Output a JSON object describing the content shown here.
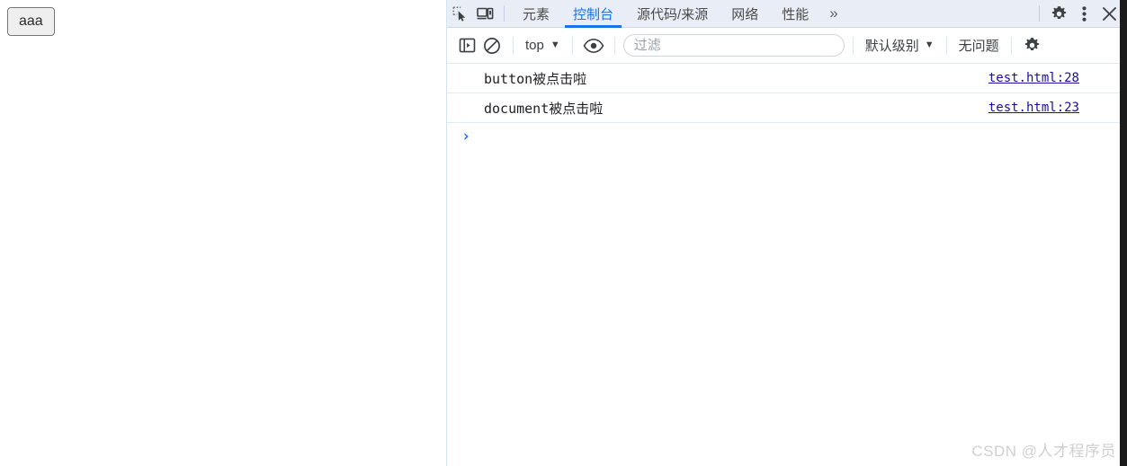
{
  "page": {
    "button_label": "aaa"
  },
  "devtools": {
    "tabstrip": {
      "inspect_icon": "inspect-element-icon",
      "device_icon": "device-toolbar-icon",
      "tabs": [
        {
          "label": "元素",
          "active": false
        },
        {
          "label": "控制台",
          "active": true
        },
        {
          "label": "源代码/来源",
          "active": false
        },
        {
          "label": "网络",
          "active": false
        },
        {
          "label": "性能",
          "active": false
        }
      ],
      "more_tabs_label": "»",
      "settings_icon": "gear-icon",
      "more_options_icon": "three-dot-menu-icon",
      "close_icon": "close-icon"
    },
    "filterbar": {
      "sidebar_toggle_icon": "console-sidebar-icon",
      "clear_icon": "clear-console-icon",
      "context_value": "top",
      "context_caret": "▼",
      "eye_icon": "live-expression-eye-icon",
      "filter_placeholder": "过滤",
      "filter_value": "",
      "level_label": "默认级别",
      "level_caret": "▼",
      "issues_label": "无问题",
      "settings_icon": "console-settings-gear-icon"
    },
    "console": {
      "messages": [
        {
          "text": "button被点击啦",
          "source": "test.html:28"
        },
        {
          "text": "document被点击啦",
          "source": "test.html:23"
        }
      ],
      "prompt_caret": "›",
      "prompt_value": ""
    }
  },
  "watermark": "CSDN @人才程序员",
  "colors": {
    "accent": "#1a73e8",
    "link": "#1a0dab",
    "tabstrip_bg": "#e9eef6",
    "text": "#3c4043"
  }
}
